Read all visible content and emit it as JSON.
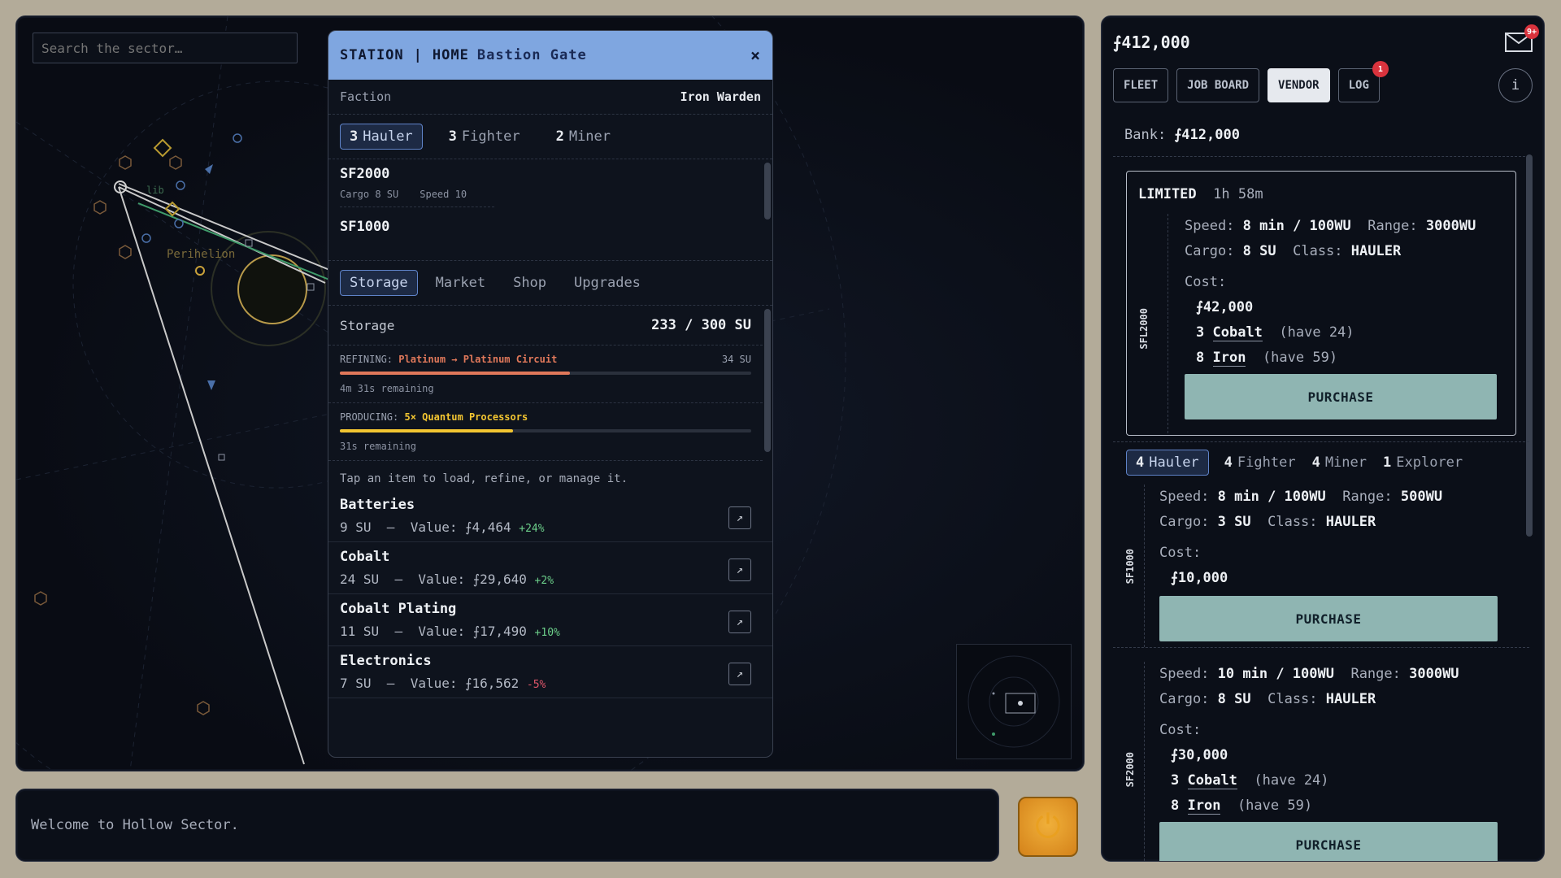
{
  "map": {
    "search_placeholder": "Search the sector…",
    "labels": {
      "perihelion": "Perihelion",
      "lib": "lib"
    }
  },
  "station": {
    "kind": "STATION",
    "divider": "|",
    "home": "HOME",
    "name": "Bastion Gate",
    "close": "×",
    "faction_label": "Faction",
    "faction_value": "Iron Warden",
    "ship_tabs": [
      {
        "count": "3",
        "label": "Hauler"
      },
      {
        "count": "3",
        "label": "Fighter"
      },
      {
        "count": "2",
        "label": "Miner"
      }
    ],
    "ships": [
      {
        "name": "SF2000",
        "cargo": "Cargo 8 SU",
        "speed": "Speed 10"
      },
      {
        "name": "SF1000"
      }
    ],
    "section_tabs": [
      "Storage",
      "Market",
      "Shop",
      "Upgrades"
    ],
    "storage_label": "Storage",
    "storage_value": "233 / 300 SU",
    "refining": {
      "label": "REFINING:",
      "what": "Platinum → Platinum Circuit",
      "units": "34 SU",
      "remaining": "4m 31s remaining",
      "progress": 0.56,
      "color": "#e0785a"
    },
    "producing": {
      "label": "PRODUCING:",
      "what": "5× Quantum Processors",
      "remaining": "31s remaining",
      "progress": 0.42,
      "color": "#f2c531"
    },
    "hint": "Tap an item to load, refine, or manage it.",
    "items": [
      {
        "name": "Batteries",
        "qty": "9 SU",
        "value": "Value: ⨍4,464",
        "delta": "+24%",
        "trend": "pos"
      },
      {
        "name": "Cobalt",
        "qty": "24 SU",
        "value": "Value: ⨍29,640",
        "delta": "+2%",
        "trend": "pos"
      },
      {
        "name": "Cobalt Plating",
        "qty": "11 SU",
        "value": "Value: ⨍17,490",
        "delta": "+10%",
        "trend": "pos"
      },
      {
        "name": "Electronics",
        "qty": "7 SU",
        "value": "Value: ⨍16,562",
        "delta": "-5%",
        "trend": "neg"
      }
    ],
    "item_action_icon": "↗"
  },
  "console": {
    "message": "Welcome to Hollow Sector."
  },
  "power_icon": "⏻",
  "side": {
    "balance": "⨍412,000",
    "mail_badge": "9+",
    "nav": [
      "FLEET",
      "JOB BOARD",
      "VENDOR",
      "LOG"
    ],
    "log_badge": "1",
    "info_icon": "i",
    "bank_label": "Bank:",
    "bank_value": "⨍412,000",
    "limited": {
      "tag": "LIMITED",
      "timer": "1h 58m",
      "model": "SFL2000",
      "speed": "8 min / 100WU",
      "range": "3000WU",
      "cargo": "8 SU",
      "class": "HAULER",
      "cost_label": "Cost:",
      "price": "⨍42,000",
      "reqs": [
        {
          "qty": "3",
          "res": "Cobalt",
          "have": "(have 24)"
        },
        {
          "qty": "8",
          "res": "Iron",
          "have": "(have 59)"
        }
      ],
      "button": "PURCHASE"
    },
    "class_tabs": [
      {
        "count": "4",
        "label": "Hauler"
      },
      {
        "count": "4",
        "label": "Fighter"
      },
      {
        "count": "4",
        "label": "Miner"
      },
      {
        "count": "1",
        "label": "Explorer"
      }
    ],
    "offers": [
      {
        "model": "SF1000",
        "speed": "8 min / 100WU",
        "range": "500WU",
        "cargo": "3 SU",
        "class": "HAULER",
        "price": "⨍10,000",
        "reqs": [],
        "button": "PURCHASE"
      },
      {
        "model": "SF2000",
        "speed": "10 min / 100WU",
        "range": "3000WU",
        "cargo": "8 SU",
        "class": "HAULER",
        "price": "⨍30,000",
        "reqs": [
          {
            "qty": "3",
            "res": "Cobalt",
            "have": "(have 24)"
          },
          {
            "qty": "8",
            "res": "Iron",
            "have": "(have 59)"
          }
        ],
        "button": "PURCHASE"
      }
    ],
    "labels": {
      "speed": "Speed:",
      "range": "Range:",
      "cargo": "Cargo:",
      "class": "Class:"
    }
  }
}
